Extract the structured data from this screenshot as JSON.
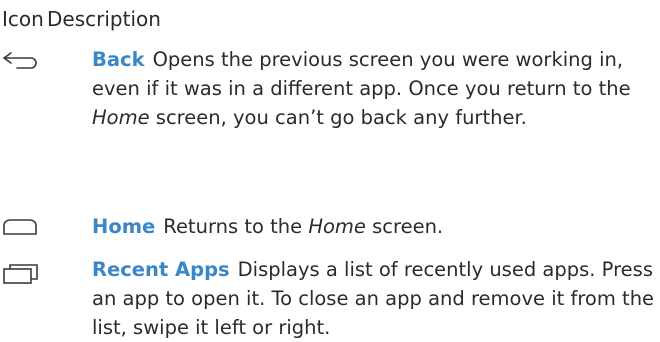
{
  "header": {
    "icon_col": "Icon",
    "description_col": "Description"
  },
  "rows": [
    {
      "icon": "back-arrow-icon",
      "term": "Back",
      "text_1": "Opens the previous screen you were working in, even if it was in a different app. Once you return to the ",
      "text_italic": "Home",
      "text_2": " screen, you can’t go back any further."
    },
    {
      "icon": "home-icon",
      "term": "Home",
      "text_1": "Returns to the ",
      "text_italic": "Home",
      "text_2": " screen."
    },
    {
      "icon": "recent-apps-icon",
      "term": "Recent Apps",
      "text_1": "Displays a list of recently used apps. Press an app to open it. To close an app and remove it from the list, swipe it left or right."
    }
  ]
}
